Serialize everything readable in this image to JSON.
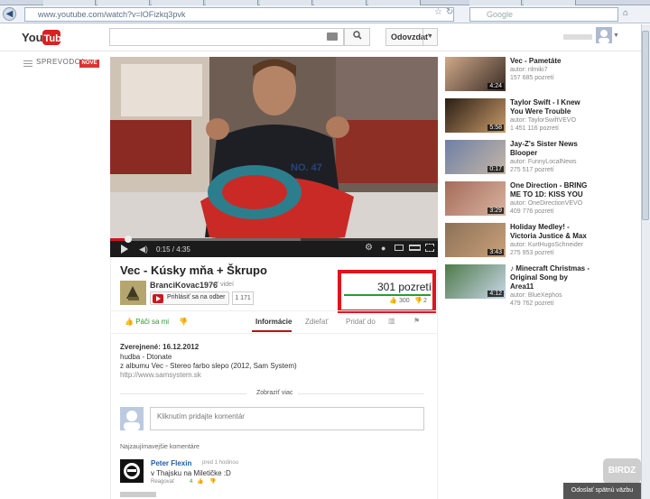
{
  "browser": {
    "url": "www.youtube.com/watch?v=lOFizkq3pvk",
    "search_placeholder": "Google"
  },
  "masthead": {
    "logo_text": "YouTube",
    "upload_label": "Odovzdať"
  },
  "guide": {
    "label": "SPREVODCA",
    "badge": "NOVÉ"
  },
  "player": {
    "time": "0:15 / 4:35",
    "progress": 0.055,
    "buffered": 0.58
  },
  "video": {
    "title": "Vec - Kúsky mňa + Škrupo",
    "channel": "BranciKovac1976",
    "video_count": "· 7 videí",
    "subscribe_label": "Prihlásiť sa na odber",
    "subscriber_count": "1 171",
    "views": "301 pozretí",
    "likes": "300",
    "dislikes": "2",
    "like_label": "Páči sa mi"
  },
  "tabs": [
    "Informácie",
    "Zdieľať",
    "Pridať do"
  ],
  "description": {
    "published": "Zverejnené: 16.12.2012",
    "lines": [
      "hudba - Dtonate",
      "z albumu Vec - Stereo farbo slepo (2012, Sam System)",
      "http://www.samsystem.sk"
    ],
    "show_more": "Zobraziť viac"
  },
  "comments": {
    "input_placeholder": "Kliknutím pridajte komentár",
    "section_title": "Najzaujímavejšie komentáre",
    "items": [
      {
        "author": "Peter Flexin",
        "time": "pred 1 hodinou",
        "text": "v Thajsku na Miletičke :D",
        "reply": "Reagovať",
        "likes": "4"
      }
    ]
  },
  "related": [
    {
      "title": "Vec - Pametáte",
      "author": "autor: nlmiki7",
      "views": "157 685 pozretí",
      "duration": "4:24",
      "colors": [
        "#cfa98a",
        "#3a2c25"
      ]
    },
    {
      "title": "Taylor Swift - I Knew You Were Trouble",
      "author": "autor: TaylorSwiftVEVO",
      "views": "1 451 116 pozretí",
      "duration": "5:58",
      "colors": [
        "#2a1e14",
        "#c89a6a"
      ]
    },
    {
      "title": "Jay-Z's Sister News Blooper",
      "author": "autor: FunnyLocalNews",
      "views": "275 517 pozretí",
      "duration": "0:17",
      "colors": [
        "#6f7fa6",
        "#c4b7a6"
      ]
    },
    {
      "title": "One Direction - BRING ME TO 1D: KISS YOU",
      "author": "autor: OneDirectionVEVO",
      "views": "409 776 pozretí",
      "duration": "3:29",
      "colors": [
        "#a66b5a",
        "#d8b4a0"
      ]
    },
    {
      "title": "Holiday Medley! - Victoria Justice & Max",
      "author": "autor: KurtHugoSchneider",
      "views": "275 953 pozretí",
      "duration": "3:43",
      "colors": [
        "#8c7157",
        "#c9a17a"
      ]
    },
    {
      "title": "♪ Minecraft Christmas - Original Song by Area11",
      "author": "autor: BlueXephos",
      "views": "479 762 pozretí",
      "duration": "4:12",
      "colors": [
        "#4e7a4a",
        "#c9d7e8"
      ]
    }
  ],
  "feedback": {
    "label": "Odoslať spätnú väzbu",
    "watermark": "BIRDZ"
  }
}
